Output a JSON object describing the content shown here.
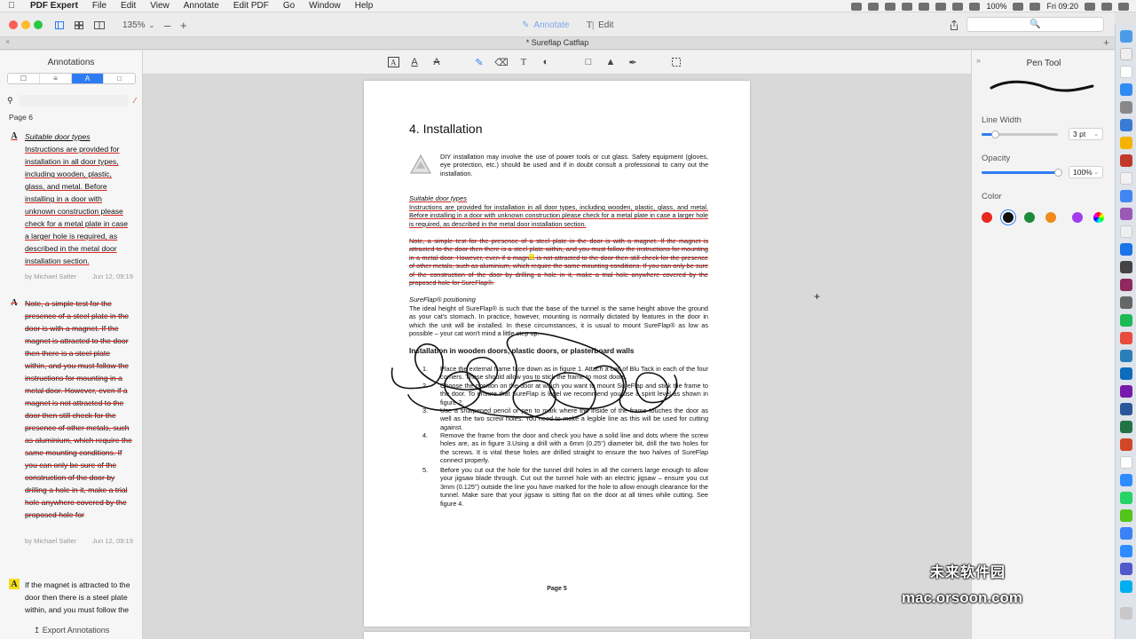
{
  "menubar": {
    "app": "PDF Expert",
    "items": [
      "File",
      "Edit",
      "View",
      "Annotate",
      "Edit PDF",
      "Go",
      "Window",
      "Help"
    ],
    "battery": "100%",
    "clock": "Fri 09:20"
  },
  "toolbar": {
    "zoom": "135%",
    "annotate_label": "Annotate",
    "edit_label": "Edit"
  },
  "tab": {
    "title": "* Sureflap Catflap"
  },
  "sidebar": {
    "title": "Annotations",
    "page_label": "Page 6",
    "export_label": "Export Annotations",
    "annotations": [
      {
        "type": "underline",
        "title": "Suitable door types",
        "text": "Instructions are provided for installation in all door types, including wooden, plastic, glass, and metal. Before installing in a door with unknown construction please check for a metal plate in case a larger hole is required, as described in the metal door installation section.",
        "author": "by Michael Salter",
        "date": "Jun 12, 09:19"
      },
      {
        "type": "strikeout",
        "text": "Note, a simple test for the presence of a steel plate in the door is with a magnet. If the magnet is attracted to the door then there is a steel plate within, and you must follow the instructions for mounting in a metal door. However, even if a magnet is not attracted to the door then still check for the presence of other metals, such as aluminium, which require the same mounting conditions. If you can only be sure of the construction of the door by drilling a hole in it, make a trial hole anywhere covered by the proposed hole for",
        "author": "by Michael Salter",
        "date": "Jun 12, 09:19"
      },
      {
        "type": "highlight",
        "text": "If the magnet is attracted to the door then there is a steel plate within, and you must follow the instructions for"
      }
    ]
  },
  "document": {
    "heading": "4. Installation",
    "warning": "DIY installation may involve the use of power tools or cut glass. Safety equipment (gloves, eye protection, etc.) should be used and if in doubt consult a professional to carry out the installation.",
    "door_types_title": "Suitable door types",
    "door_types_text": "Instructions are provided for installation in all door types, including wooden, plastic, glass, and metal. Before installing in a door with unknown construction please check for a metal plate in case a larger hole is required, as described in the metal door installation section.",
    "note_text": "Note, a simple test for the presence of a steel plate in the door is with a magnet. If the magnet is attracted to the door then there is a steel plate within, and you must follow the instructions for mounting in a metal door. However, even if a magnet is not attracted to the door then still check for the presence of other metals, such as aluminium, which require the same mounting conditions. If you can only be sure of the construction of the door by drilling a hole in it, make a trial hole anywhere covered by the proposed hole for SureFlap®.",
    "positioning_title": "SureFlap® positioning",
    "positioning_text": "The ideal height of SureFlap® is such that the base of the tunnel is the same height above the ground as your cat's stomach. In practice, however, mounting is normally dictated by features in the door in which the unit will be installed. In these circumstances, it is usual to mount SureFlap® as low as possible – your cat won't mind a little step up.",
    "section_title": "Installation in wooden doors, plastic doors, or plasterboard walls",
    "steps": [
      {
        "num": "1.",
        "text": "Place the external frame face down as in figure 1. Attach a ball of Blu Tack in each of the four corners. These should allow you to stick the frame to most doors."
      },
      {
        "num": "2.",
        "text": "Choose the position on the door at which you want to mount SureFlap and stick the frame to the door. To ensure that SureFlap is level we recommend you use a spirit level as shown in figure 2."
      },
      {
        "num": "3.",
        "text": "Use a sharpened pencil or pen to mark where the inside of the frame touches the door as well as the two screw holes. You need to make a legible line as this will be used for cutting against."
      },
      {
        "num": "4.",
        "text": "Remove the frame from the door and check you have a solid line and dots where the screw holes are, as in figure 3.Using a drill with a 6mm (0.25\") diameter bit, drill the two holes for the screws. It is vital these holes are drilled straight to ensure the two halves of SureFlap connect properly."
      },
      {
        "num": "5.",
        "text": "Before you cut out the hole for the tunnel drill holes in all the corners large enough to allow your jigsaw blade through. Cut out the tunnel hole with an electric jigsaw – ensure you cut 3mm (0.125\") outside the line you have marked for the hole to allow enough clearance for the tunnel. Make sure that your jigsaw is sitting flat on the door at all times while cutting. See figure 4."
      }
    ],
    "footer": "Page 5"
  },
  "inspector": {
    "title": "Pen Tool",
    "line_width_label": "Line Width",
    "line_width_value": "3 pt",
    "line_width_level": 0.18,
    "opacity_label": "Opacity",
    "opacity_value": "100%",
    "opacity_level": 1.0,
    "color_label": "Color",
    "colors": [
      "#e8271e",
      "#111111",
      "#1f8a3a",
      "#f08a1a",
      "#a23cf0"
    ],
    "selected_color": "#111111"
  },
  "watermark": {
    "line1": "未来软件园",
    "line2": "mac.orsoon.com"
  }
}
